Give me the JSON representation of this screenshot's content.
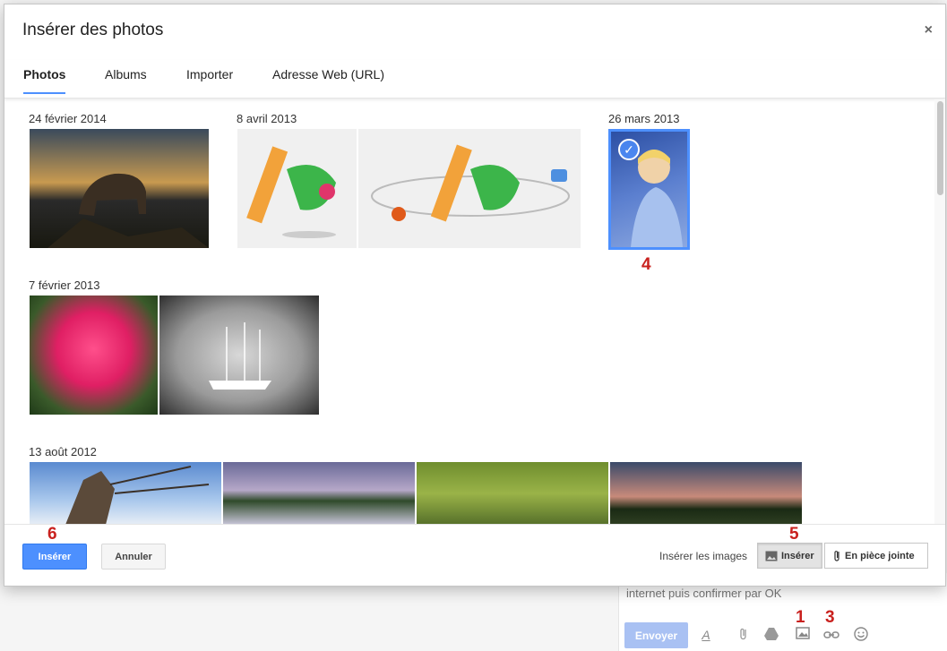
{
  "dialog": {
    "title": "Insérer des photos",
    "close_label": "×",
    "tabs": [
      {
        "label": "Photos",
        "active": true
      },
      {
        "label": "Albums",
        "active": false
      },
      {
        "label": "Importer",
        "active": false
      },
      {
        "label": "Adresse Web (URL)",
        "active": false
      }
    ],
    "groups": [
      {
        "date": "24 février 2014"
      },
      {
        "date": "8 avril 2013"
      },
      {
        "date": "26 mars 2013"
      },
      {
        "date": "7 février 2013"
      },
      {
        "date": "13 août 2012"
      }
    ],
    "selected_check": "✓",
    "footer": {
      "insert_button": "Insérer",
      "cancel_button": "Annuler",
      "insert_images_label": "Insérer les images",
      "inline_option": "Insérer",
      "attachment_option": "En pièce jointe"
    }
  },
  "background": {
    "compose_text": "internet puis confirmer par OK",
    "send_button": "Envoyer"
  },
  "annotations": [
    "1",
    "3",
    "4",
    "5",
    "6"
  ],
  "colors": {
    "accent": "#4d90fe",
    "annotation": "#c9211e",
    "selection": "#4d90fe"
  }
}
